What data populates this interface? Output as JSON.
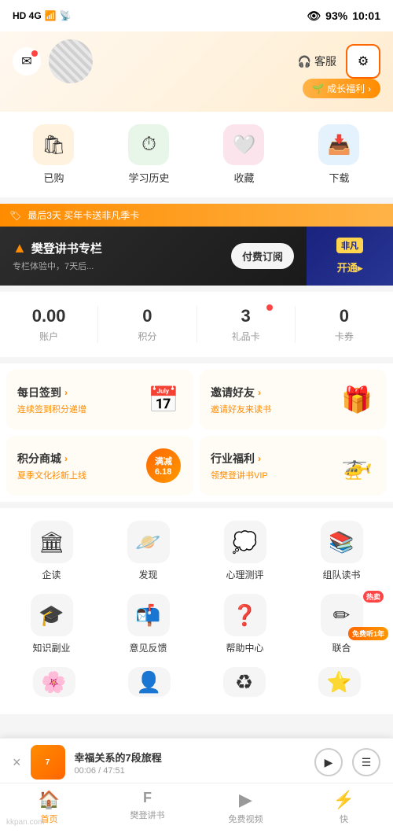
{
  "statusBar": {
    "left": "HD 4G",
    "battery": "93",
    "time": "10:01",
    "wifiIcon": "wifi",
    "signalIcon": "signal"
  },
  "header": {
    "kefuLabel": "客服",
    "growthLabel": "成长福利",
    "growthArrow": "›"
  },
  "quickIcons": [
    {
      "id": "purchased",
      "label": "已购",
      "icon": "🛍"
    },
    {
      "id": "history",
      "label": "学习历史",
      "icon": "⏱"
    },
    {
      "id": "favorites",
      "label": "收藏",
      "icon": "🤍"
    },
    {
      "id": "download",
      "label": "下载",
      "icon": "📥"
    }
  ],
  "promoBanner": {
    "icon": "🏷",
    "text": "最后3天 买年卡送非凡季卡"
  },
  "fanCard": {
    "icon": "▲",
    "title": "樊登讲书专栏",
    "subtitle": "专栏体验中，7天后...",
    "btnLabel": "付费订阅"
  },
  "vipCard": {
    "badge": "非凡",
    "label": "开通▸"
  },
  "stats": [
    {
      "id": "account",
      "value": "0.00",
      "label": "账户",
      "hasDot": false
    },
    {
      "id": "points",
      "value": "0",
      "label": "积分",
      "hasDot": false
    },
    {
      "id": "giftcard",
      "value": "3",
      "label": "礼品卡",
      "hasDot": true
    },
    {
      "id": "coupon",
      "value": "0",
      "label": "卡券",
      "hasDot": false
    }
  ],
  "featureCards": [
    {
      "id": "daily-checkin",
      "title": "每日签到",
      "arrow": "›",
      "sub": "连续签到积分递增",
      "iconEmoji": "📅"
    },
    {
      "id": "invite-friend",
      "title": "邀请好友",
      "arrow": "›",
      "sub": "邀请好友来读书",
      "iconEmoji": "🎁"
    },
    {
      "id": "points-mall",
      "title": "积分商城",
      "arrow": "›",
      "sub": "夏季文化衫新上线",
      "iconEmoji": "🛒"
    },
    {
      "id": "industry-benefit",
      "title": "行业福利",
      "arrow": "›",
      "sub": "领樊登讲书VIP",
      "iconEmoji": "🎫"
    }
  ],
  "gridIcons": [
    {
      "id": "enterprise-read",
      "label": "企读",
      "icon": "🏛",
      "badge": null
    },
    {
      "id": "discover",
      "label": "发现",
      "icon": "🪐",
      "badge": null
    },
    {
      "id": "psych-test",
      "label": "心理测评",
      "icon": "💭",
      "badge": null
    },
    {
      "id": "team-read",
      "label": "组队读书",
      "icon": "📚",
      "badge": null
    },
    {
      "id": "knowledge-side",
      "label": "知识副业",
      "icon": "🎓",
      "badge": null
    },
    {
      "id": "feedback",
      "label": "意见反馈",
      "icon": "📬",
      "badge": null
    },
    {
      "id": "help-center",
      "label": "帮助中心",
      "icon": "❓",
      "badge": null
    },
    {
      "id": "joint",
      "label": "联合",
      "icon": "✏",
      "badge": "热卖",
      "freeBadge": "免费听1年"
    }
  ],
  "bottomPlayer": {
    "closeLabel": "×",
    "thumbText": "7",
    "title": "幸福关系的7段旅程",
    "time": "00:06 / 47:51",
    "playIcon": "▶",
    "listIcon": "☰"
  },
  "bottomNav": [
    {
      "id": "home",
      "label": "首页",
      "icon": "🏠",
      "active": true
    },
    {
      "id": "fandeng",
      "label": "樊登讲书",
      "icon": "F",
      "active": false
    },
    {
      "id": "free-video",
      "label": "免费视频",
      "icon": "▶",
      "active": false
    },
    {
      "id": "kuai",
      "label": "快",
      "icon": "⚡",
      "active": false
    }
  ],
  "watermark": "kkpan.com"
}
